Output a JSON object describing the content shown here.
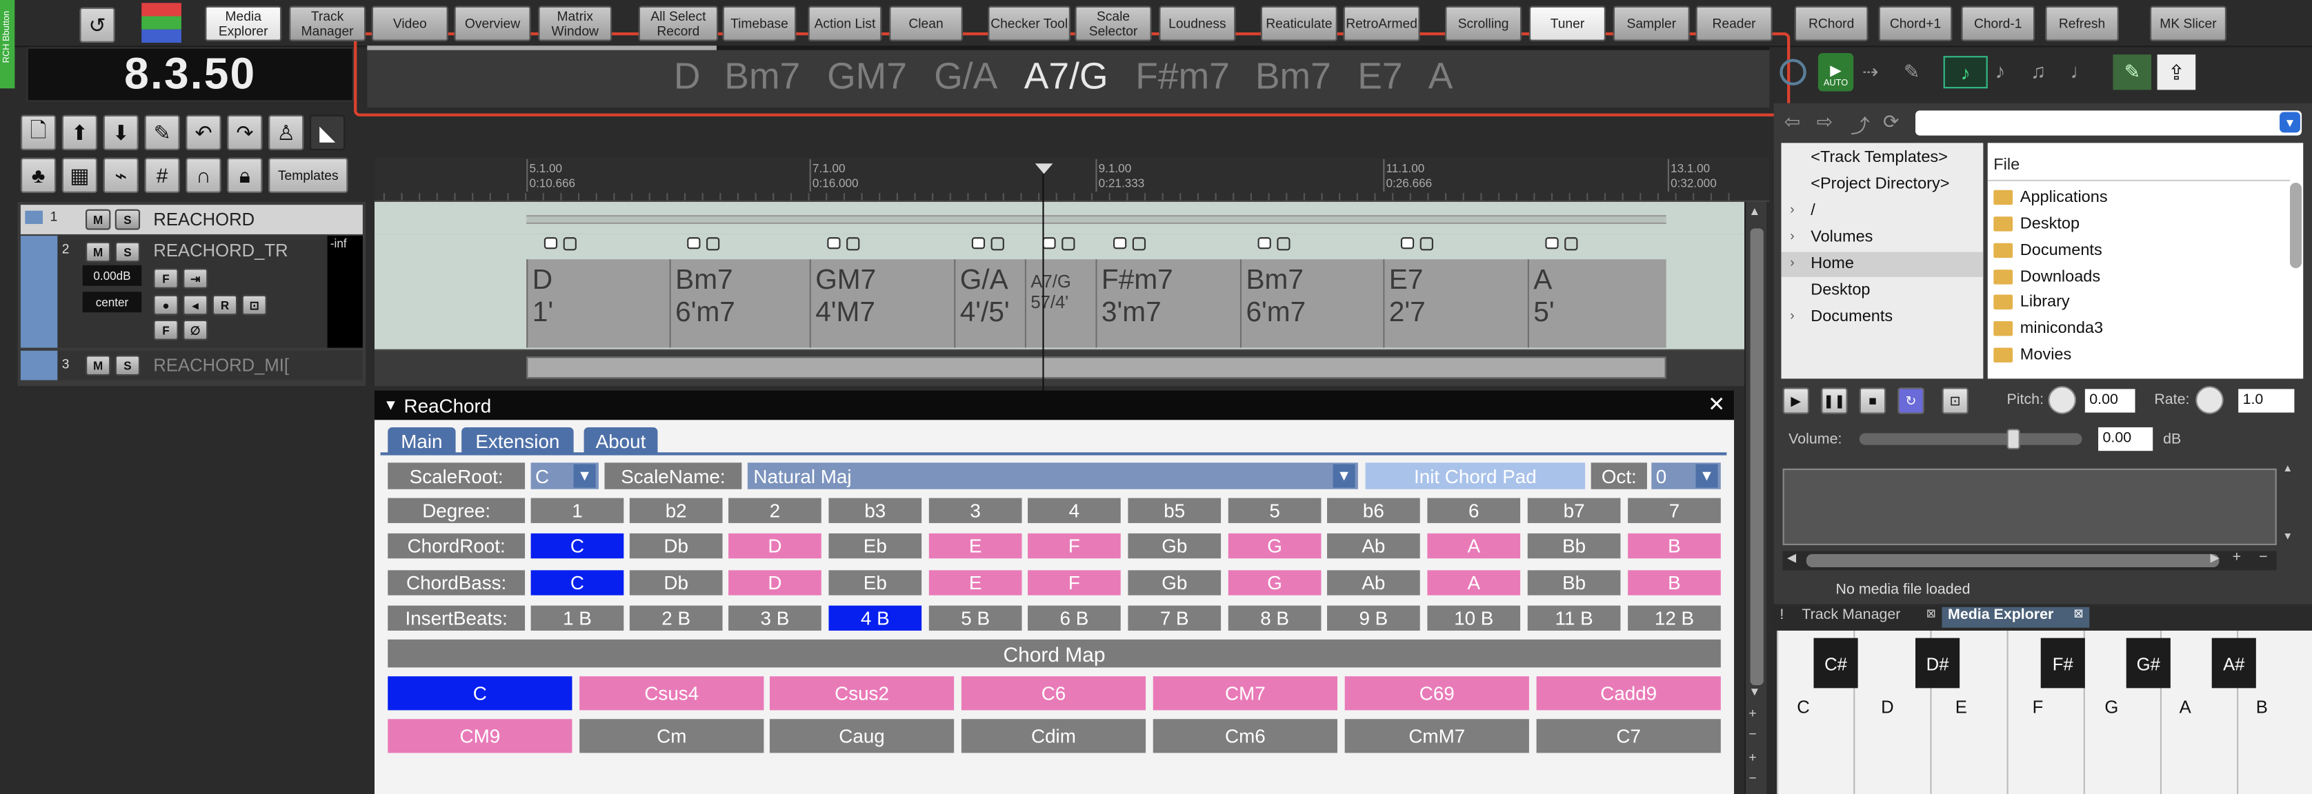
{
  "toolbar": {
    "buttons": [
      "Media\nExplorer",
      "Track\nManager",
      "Video",
      "Overview",
      "Matrix\nWindow",
      "All Select\nRecord",
      "Timebase",
      "Action List",
      "Clean",
      "Checker Tool",
      "Scale\nSelector",
      "Loudness",
      "Reaticulate",
      "RetroArmed",
      "Scrolling",
      "Tuner",
      "Sampler",
      "Reader",
      "RChord",
      "Chord+1",
      "Chord-1",
      "Refresh",
      "MK Slicer"
    ],
    "left_tab": "RCH Bbutton"
  },
  "time_display": "8.3.50",
  "chord_bar": {
    "chords": [
      "D",
      "Bm7",
      "GM7",
      "G/A",
      "A7/G",
      "F#m7",
      "Bm7",
      "E7",
      "A"
    ],
    "current_index": 4
  },
  "main_toolbar": {
    "templates_label": "Templates"
  },
  "ruler": {
    "marks": [
      {
        "bar": "5.1.00",
        "time": "0:10.666"
      },
      {
        "bar": "7.1.00",
        "time": "0:16.000"
      },
      {
        "bar": "9.1.00",
        "time": "0:21.333"
      },
      {
        "bar": "11.1.00",
        "time": "0:26.666"
      },
      {
        "bar": "13.1.00",
        "time": "0:32.000"
      }
    ]
  },
  "tracks": [
    {
      "num": "1",
      "name": "REACHORD",
      "mute": "M",
      "solo": "S"
    },
    {
      "num": "2",
      "name": "REACHORD_TR",
      "mute": "M",
      "solo": "S",
      "volume": "0.00dB",
      "pan": "center",
      "meter": "-inf"
    },
    {
      "num": "3",
      "name": "REACHORD_MI[",
      "mute": "M",
      "solo": "S"
    }
  ],
  "arrange_chords": [
    {
      "name": "D",
      "degree": "1'"
    },
    {
      "name": "Bm7",
      "degree": "6'm7"
    },
    {
      "name": "GM7",
      "degree": "4'M7"
    },
    {
      "name": "G/A",
      "degree": "4'/5'"
    },
    {
      "name": "A7/G",
      "degree": "57/4'"
    },
    {
      "name": "F#m7",
      "degree": "3'm7"
    },
    {
      "name": "Bm7",
      "degree": "6'm7"
    },
    {
      "name": "E7",
      "degree": "2'7"
    },
    {
      "name": "A",
      "degree": "5'"
    }
  ],
  "reachord": {
    "title": "ReaChord",
    "tabs": [
      "Main",
      "Extension",
      "About"
    ],
    "scale_root_label": "ScaleRoot:",
    "scale_root_value": "C",
    "scale_name_label": "ScaleName:",
    "scale_name_value": "Natural Maj",
    "init_chord_pad": "Init Chord Pad",
    "oct_label": "Oct:",
    "oct_value": "0",
    "rows": [
      {
        "label": "Degree:",
        "cells": [
          "1",
          "b2",
          "2",
          "b3",
          "3",
          "4",
          "b5",
          "5",
          "b6",
          "6",
          "b7",
          "7"
        ]
      },
      {
        "label": "ChordRoot:",
        "cells": [
          "C",
          "Db",
          "D",
          "Eb",
          "E",
          "F",
          "Gb",
          "G",
          "Ab",
          "A",
          "Bb",
          "B"
        ]
      },
      {
        "label": "ChordBass:",
        "cells": [
          "C",
          "Db",
          "D",
          "Eb",
          "E",
          "F",
          "Gb",
          "G",
          "Ab",
          "A",
          "Bb",
          "B"
        ]
      },
      {
        "label": "InsertBeats:",
        "cells": [
          "1 B",
          "2 B",
          "3 B",
          "4 B",
          "5 B",
          "6 B",
          "7 B",
          "8 B",
          "9 B",
          "10 B",
          "11 B",
          "12 B"
        ]
      }
    ],
    "chord_map_label": "Chord Map",
    "chord_map_row1": [
      "C",
      "Csus4",
      "Csus2",
      "C6",
      "CM7",
      "C69",
      "Cadd9"
    ],
    "chord_map_row2": [
      "CM9",
      "Cm",
      "Caug",
      "Cdim",
      "Cm6",
      "CmM7",
      "C7"
    ]
  },
  "media_explorer": {
    "tree": [
      "<Track Templates>",
      "<Project Directory>",
      "/",
      "Volumes",
      "Home",
      "Desktop",
      "Documents"
    ],
    "file_header": "File",
    "files": [
      "Applications",
      "Desktop",
      "Documents",
      "Downloads",
      "Library",
      "miniconda3",
      "Movies"
    ],
    "pitch_label": "Pitch:",
    "pitch_value": "0.00",
    "rate_label": "Rate:",
    "rate_value": "1.0",
    "volume_label": "Volume:",
    "volume_value": "0.00",
    "volume_unit": "dB",
    "no_media": "No media file loaded",
    "auto_label": "AUTO"
  },
  "docker_tabs": [
    "Track Manager",
    "Media Explorer"
  ],
  "piano": {
    "white_keys": [
      "C",
      "D",
      "E",
      "F",
      "G",
      "A",
      "B"
    ],
    "black_keys": [
      "C#",
      "D#",
      "F#",
      "G#",
      "A#"
    ]
  },
  "colors": {
    "accent_pink": "#e97ab8",
    "accent_blue": "#0720f0",
    "highlight_red": "#d9422e"
  }
}
